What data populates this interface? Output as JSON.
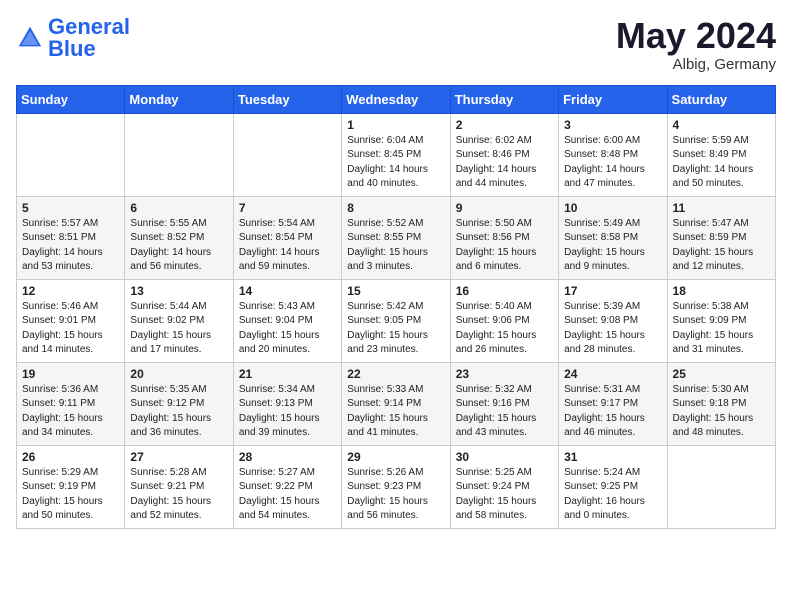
{
  "header": {
    "logo_general": "General",
    "logo_blue": "Blue",
    "month_title": "May 2024",
    "location": "Albig, Germany"
  },
  "days_of_week": [
    "Sunday",
    "Monday",
    "Tuesday",
    "Wednesday",
    "Thursday",
    "Friday",
    "Saturday"
  ],
  "weeks": [
    [
      {
        "day": "",
        "sunrise": "",
        "sunset": "",
        "daylight": ""
      },
      {
        "day": "",
        "sunrise": "",
        "sunset": "",
        "daylight": ""
      },
      {
        "day": "",
        "sunrise": "",
        "sunset": "",
        "daylight": ""
      },
      {
        "day": "1",
        "sunrise": "Sunrise: 6:04 AM",
        "sunset": "Sunset: 8:45 PM",
        "daylight": "Daylight: 14 hours and 40 minutes."
      },
      {
        "day": "2",
        "sunrise": "Sunrise: 6:02 AM",
        "sunset": "Sunset: 8:46 PM",
        "daylight": "Daylight: 14 hours and 44 minutes."
      },
      {
        "day": "3",
        "sunrise": "Sunrise: 6:00 AM",
        "sunset": "Sunset: 8:48 PM",
        "daylight": "Daylight: 14 hours and 47 minutes."
      },
      {
        "day": "4",
        "sunrise": "Sunrise: 5:59 AM",
        "sunset": "Sunset: 8:49 PM",
        "daylight": "Daylight: 14 hours and 50 minutes."
      }
    ],
    [
      {
        "day": "5",
        "sunrise": "Sunrise: 5:57 AM",
        "sunset": "Sunset: 8:51 PM",
        "daylight": "Daylight: 14 hours and 53 minutes."
      },
      {
        "day": "6",
        "sunrise": "Sunrise: 5:55 AM",
        "sunset": "Sunset: 8:52 PM",
        "daylight": "Daylight: 14 hours and 56 minutes."
      },
      {
        "day": "7",
        "sunrise": "Sunrise: 5:54 AM",
        "sunset": "Sunset: 8:54 PM",
        "daylight": "Daylight: 14 hours and 59 minutes."
      },
      {
        "day": "8",
        "sunrise": "Sunrise: 5:52 AM",
        "sunset": "Sunset: 8:55 PM",
        "daylight": "Daylight: 15 hours and 3 minutes."
      },
      {
        "day": "9",
        "sunrise": "Sunrise: 5:50 AM",
        "sunset": "Sunset: 8:56 PM",
        "daylight": "Daylight: 15 hours and 6 minutes."
      },
      {
        "day": "10",
        "sunrise": "Sunrise: 5:49 AM",
        "sunset": "Sunset: 8:58 PM",
        "daylight": "Daylight: 15 hours and 9 minutes."
      },
      {
        "day": "11",
        "sunrise": "Sunrise: 5:47 AM",
        "sunset": "Sunset: 8:59 PM",
        "daylight": "Daylight: 15 hours and 12 minutes."
      }
    ],
    [
      {
        "day": "12",
        "sunrise": "Sunrise: 5:46 AM",
        "sunset": "Sunset: 9:01 PM",
        "daylight": "Daylight: 15 hours and 14 minutes."
      },
      {
        "day": "13",
        "sunrise": "Sunrise: 5:44 AM",
        "sunset": "Sunset: 9:02 PM",
        "daylight": "Daylight: 15 hours and 17 minutes."
      },
      {
        "day": "14",
        "sunrise": "Sunrise: 5:43 AM",
        "sunset": "Sunset: 9:04 PM",
        "daylight": "Daylight: 15 hours and 20 minutes."
      },
      {
        "day": "15",
        "sunrise": "Sunrise: 5:42 AM",
        "sunset": "Sunset: 9:05 PM",
        "daylight": "Daylight: 15 hours and 23 minutes."
      },
      {
        "day": "16",
        "sunrise": "Sunrise: 5:40 AM",
        "sunset": "Sunset: 9:06 PM",
        "daylight": "Daylight: 15 hours and 26 minutes."
      },
      {
        "day": "17",
        "sunrise": "Sunrise: 5:39 AM",
        "sunset": "Sunset: 9:08 PM",
        "daylight": "Daylight: 15 hours and 28 minutes."
      },
      {
        "day": "18",
        "sunrise": "Sunrise: 5:38 AM",
        "sunset": "Sunset: 9:09 PM",
        "daylight": "Daylight: 15 hours and 31 minutes."
      }
    ],
    [
      {
        "day": "19",
        "sunrise": "Sunrise: 5:36 AM",
        "sunset": "Sunset: 9:11 PM",
        "daylight": "Daylight: 15 hours and 34 minutes."
      },
      {
        "day": "20",
        "sunrise": "Sunrise: 5:35 AM",
        "sunset": "Sunset: 9:12 PM",
        "daylight": "Daylight: 15 hours and 36 minutes."
      },
      {
        "day": "21",
        "sunrise": "Sunrise: 5:34 AM",
        "sunset": "Sunset: 9:13 PM",
        "daylight": "Daylight: 15 hours and 39 minutes."
      },
      {
        "day": "22",
        "sunrise": "Sunrise: 5:33 AM",
        "sunset": "Sunset: 9:14 PM",
        "daylight": "Daylight: 15 hours and 41 minutes."
      },
      {
        "day": "23",
        "sunrise": "Sunrise: 5:32 AM",
        "sunset": "Sunset: 9:16 PM",
        "daylight": "Daylight: 15 hours and 43 minutes."
      },
      {
        "day": "24",
        "sunrise": "Sunrise: 5:31 AM",
        "sunset": "Sunset: 9:17 PM",
        "daylight": "Daylight: 15 hours and 46 minutes."
      },
      {
        "day": "25",
        "sunrise": "Sunrise: 5:30 AM",
        "sunset": "Sunset: 9:18 PM",
        "daylight": "Daylight: 15 hours and 48 minutes."
      }
    ],
    [
      {
        "day": "26",
        "sunrise": "Sunrise: 5:29 AM",
        "sunset": "Sunset: 9:19 PM",
        "daylight": "Daylight: 15 hours and 50 minutes."
      },
      {
        "day": "27",
        "sunrise": "Sunrise: 5:28 AM",
        "sunset": "Sunset: 9:21 PM",
        "daylight": "Daylight: 15 hours and 52 minutes."
      },
      {
        "day": "28",
        "sunrise": "Sunrise: 5:27 AM",
        "sunset": "Sunset: 9:22 PM",
        "daylight": "Daylight: 15 hours and 54 minutes."
      },
      {
        "day": "29",
        "sunrise": "Sunrise: 5:26 AM",
        "sunset": "Sunset: 9:23 PM",
        "daylight": "Daylight: 15 hours and 56 minutes."
      },
      {
        "day": "30",
        "sunrise": "Sunrise: 5:25 AM",
        "sunset": "Sunset: 9:24 PM",
        "daylight": "Daylight: 15 hours and 58 minutes."
      },
      {
        "day": "31",
        "sunrise": "Sunrise: 5:24 AM",
        "sunset": "Sunset: 9:25 PM",
        "daylight": "Daylight: 16 hours and 0 minutes."
      },
      {
        "day": "",
        "sunrise": "",
        "sunset": "",
        "daylight": ""
      }
    ]
  ]
}
